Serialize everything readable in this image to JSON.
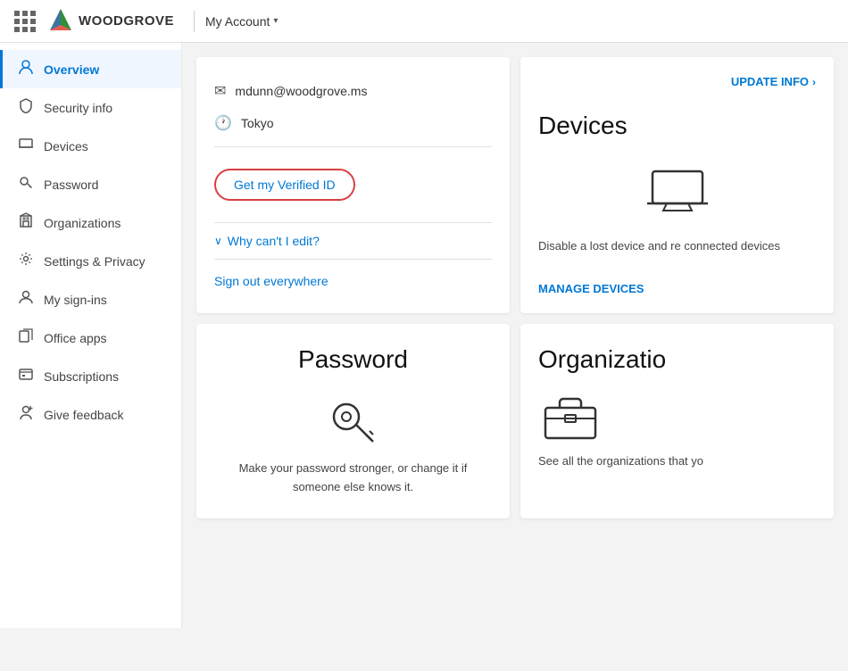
{
  "header": {
    "brand": "WOODGROVE",
    "account_label": "My Account",
    "chevron": "▾",
    "update_info_label": "UPDATE INFO",
    "update_info_arrow": "›"
  },
  "sidebar": {
    "items": [
      {
        "id": "overview",
        "label": "Overview",
        "icon": "person",
        "active": true
      },
      {
        "id": "security-info",
        "label": "Security info",
        "icon": "shield"
      },
      {
        "id": "devices",
        "label": "Devices",
        "icon": "laptop"
      },
      {
        "id": "password",
        "label": "Password",
        "icon": "key"
      },
      {
        "id": "organizations",
        "label": "Organizations",
        "icon": "building"
      },
      {
        "id": "settings-privacy",
        "label": "Settings & Privacy",
        "icon": "settings"
      },
      {
        "id": "my-sign-ins",
        "label": "My sign-ins",
        "icon": "signin"
      },
      {
        "id": "office-apps",
        "label": "Office apps",
        "icon": "office"
      },
      {
        "id": "subscriptions",
        "label": "Subscriptions",
        "icon": "subscriptions"
      },
      {
        "id": "give-feedback",
        "label": "Give feedback",
        "icon": "feedback"
      }
    ]
  },
  "profile_card": {
    "email": "mdunn@woodgrove.ms",
    "location": "Tokyo",
    "verified_id_label": "Get my Verified ID",
    "why_edit_label": "Why can't I edit?",
    "sign_out_label": "Sign out everywhere"
  },
  "devices_card": {
    "title": "Devices",
    "update_info_label": "UPDATE INFO",
    "description": "Disable a lost device and re connected devices",
    "manage_label": "MANAGE DEVICES"
  },
  "password_card": {
    "title": "Password",
    "description": "Make your password stronger, or change it if someone else knows it."
  },
  "organizations_card": {
    "title": "Organizatio",
    "description": "See all the organizations that yo"
  }
}
